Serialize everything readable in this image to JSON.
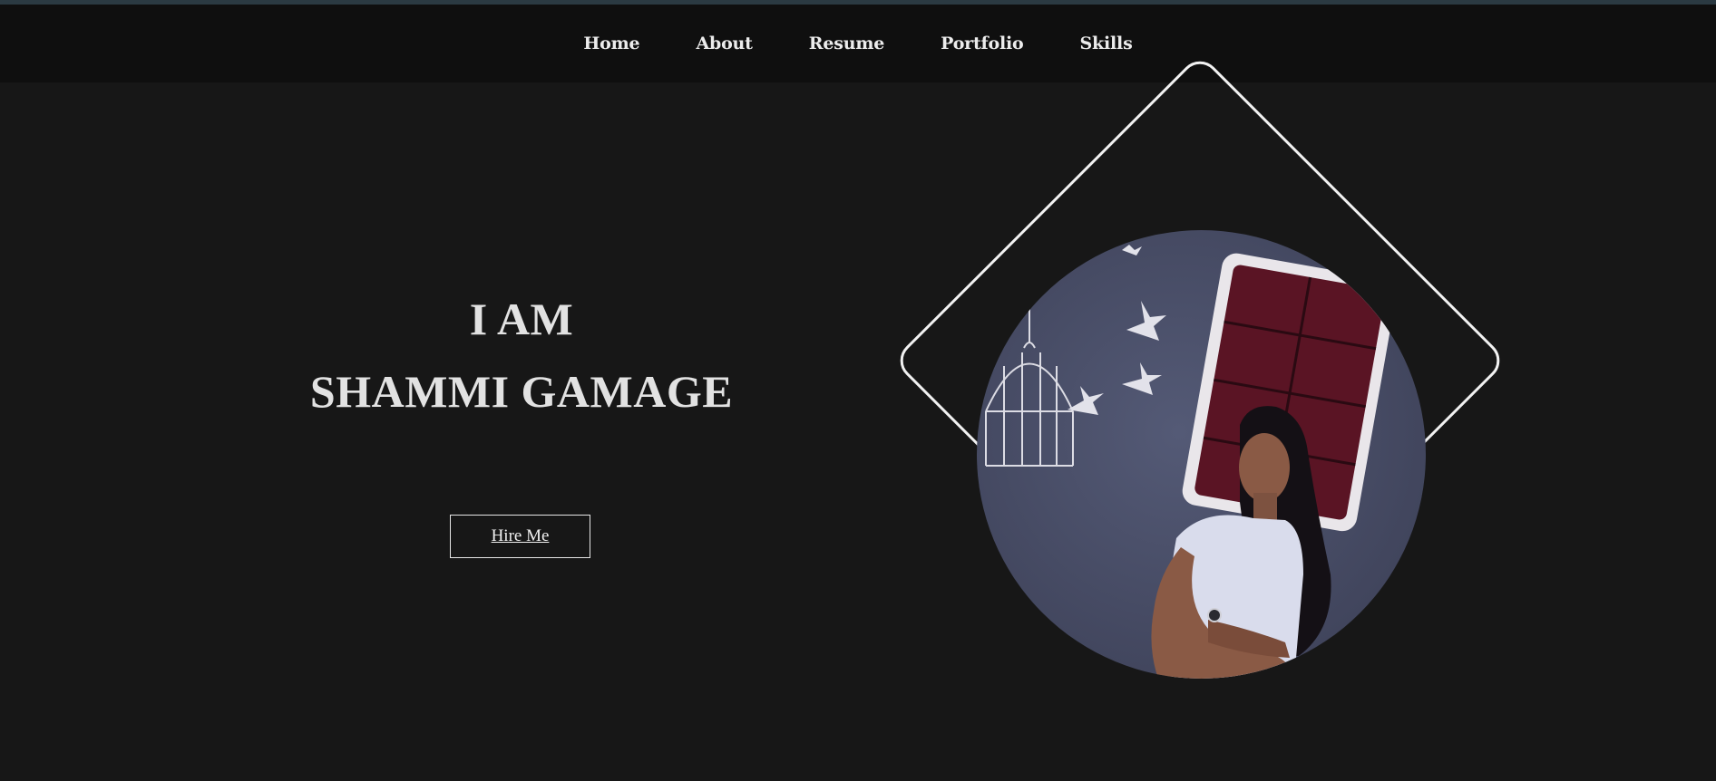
{
  "nav": {
    "items": [
      {
        "label": "Home"
      },
      {
        "label": "About"
      },
      {
        "label": "Resume"
      },
      {
        "label": "Portfolio"
      },
      {
        "label": "Skills"
      }
    ]
  },
  "hero": {
    "line1": "I AM",
    "line2": "SHAMMI GAMAGE",
    "hire_label": "Hire Me"
  },
  "portrait": {
    "icon": "profile-photo",
    "bg_color": "#4c5069",
    "frame_color": "#f2f2f2"
  },
  "colors": {
    "page_bg": "#171717",
    "nav_bg": "#0f0f0f",
    "top_strip": "#2b3a42",
    "text": "#e2e2e2"
  }
}
